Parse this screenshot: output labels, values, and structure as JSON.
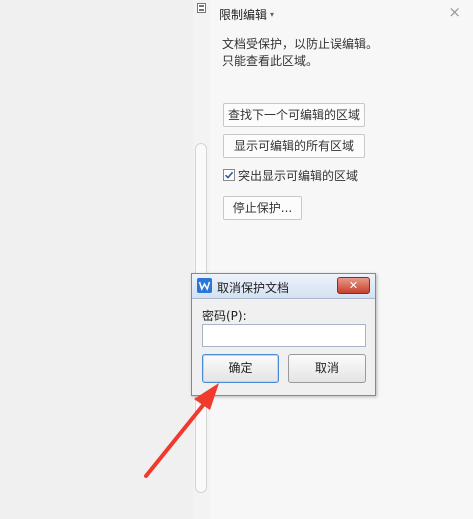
{
  "panel": {
    "title": "限制编辑",
    "caret": "▾",
    "close": "×",
    "description_line1": "文档受保护，以防止误编辑。",
    "description_line2": "只能查看此区域。",
    "find_next_button": "查找下一个可编辑的区域",
    "show_all_button": "显示可编辑的所有区域",
    "highlight_checkbox_label": "突出显示可编辑的区域",
    "highlight_checked": true,
    "stop_protection_button": "停止保护..."
  },
  "dialog": {
    "title": "取消保护文档",
    "close": "✕",
    "password_label": "密码(P):",
    "password_value": "",
    "ok_button": "确定",
    "cancel_button": "取消"
  },
  "annotation": {
    "arrow_color": "#f03a2e"
  }
}
